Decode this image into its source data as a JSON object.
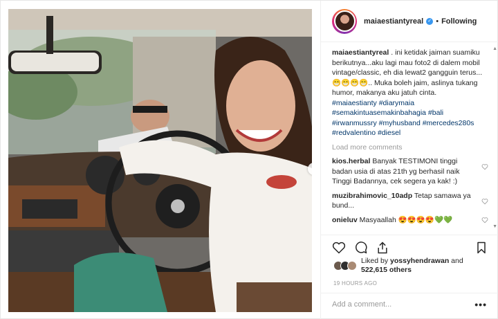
{
  "post": {
    "username": "maiaestiantyreal",
    "separator": "•",
    "follow_status": "Following",
    "caption_user": "maiaestiantyreal",
    "caption_text": " . ini ketidak jaiman suamiku berikutnya...aku lagi mau foto2 di dalem mobil vintage/classic, eh dia lewat2 gangguin terus... 😁😁😁😁.. Muka boleh jaim, aslinya tukang humor, makanya aku jatuh cinta.",
    "hashtags_line1": "#maiaestianty #diarymaia",
    "hashtags_line2": "#semakintuasemakinbahagia #bali",
    "hashtags_line3": "#irwanmussry #myhusband #mercedes280s",
    "hashtags_line4": "#redvalentino #diesel",
    "load_more": "Load more comments",
    "comments": [
      {
        "user": "kios.herbal",
        "text": " Banyak TESTIMONI tinggi badan usia di atas 21th yg berhasil naik Tinggi Badannya, cek segera ya kak! :)"
      },
      {
        "user": "muzibrahimovic_10adp",
        "text": " Tetap samawa ya bund..."
      },
      {
        "user": "onieluv",
        "text": " Masyaallah 😍😍😍😍💚💚"
      }
    ],
    "liked_by_prefix": "Liked by ",
    "liked_by_user": "yossyhendrawan",
    "liked_and": " and",
    "likes_count": "522,615 others",
    "time_ago": "19 HOURS AGO",
    "add_comment_placeholder": "Add a comment...",
    "more_options": "•••",
    "verified_mark": "✓",
    "next_arrow": "›",
    "scroll_up": "▲",
    "scroll_down": "▼"
  },
  "colors": {
    "link": "#003569",
    "accent": "#3897f0",
    "muted": "#999999"
  },
  "icons": [
    "heart-icon",
    "comment-icon",
    "share-icon",
    "bookmark-icon",
    "verified-badge-icon",
    "next-arrow-icon"
  ]
}
